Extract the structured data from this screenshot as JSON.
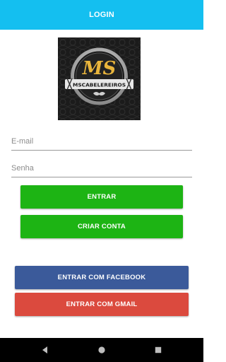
{
  "app_bar": {
    "title": "LOGIN",
    "color": "#14bff0"
  },
  "logo": {
    "monogram": "MS",
    "wordmark": "MSCABELEREIROS",
    "icon": "barber-logo"
  },
  "form": {
    "email_placeholder": "E-mail",
    "password_placeholder": "Senha"
  },
  "buttons": {
    "enter_label": "ENTRAR",
    "create_account_label": "CRIAR CONTA",
    "facebook_label": "ENTRAR COM FACEBOOK",
    "gmail_label": "ENTRAR COM GMAIL"
  },
  "colors": {
    "primary_green": "#1db414",
    "facebook_blue": "#3b5a9a",
    "gmail_red": "#db4a3e"
  },
  "navigation_bar": {
    "icons": [
      "back-icon",
      "home-icon",
      "recents-icon"
    ]
  }
}
